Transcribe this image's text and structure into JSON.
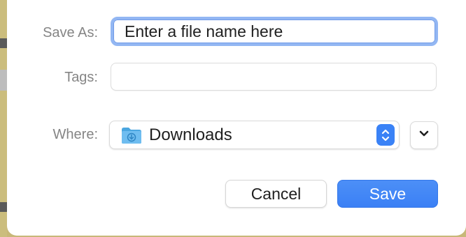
{
  "dialog": {
    "save_as_label": "Save As:",
    "tags_label": "Tags:",
    "where_label": "Where:"
  },
  "fields": {
    "filename_placeholder": "Enter a file name here",
    "filename_value": "",
    "tags_value": "",
    "tags_placeholder": ""
  },
  "location": {
    "selected": "Downloads",
    "icon": "downloads-folder-icon",
    "stepper_icon": "up-down-chevron-icon",
    "expand_icon": "chevron-down-icon"
  },
  "buttons": {
    "cancel_label": "Cancel",
    "save_label": "Save"
  },
  "colors": {
    "accent": "#3b80f5",
    "focus_ring": "#93b7f3",
    "label": "#858585",
    "folder": "#5ab0e6"
  }
}
